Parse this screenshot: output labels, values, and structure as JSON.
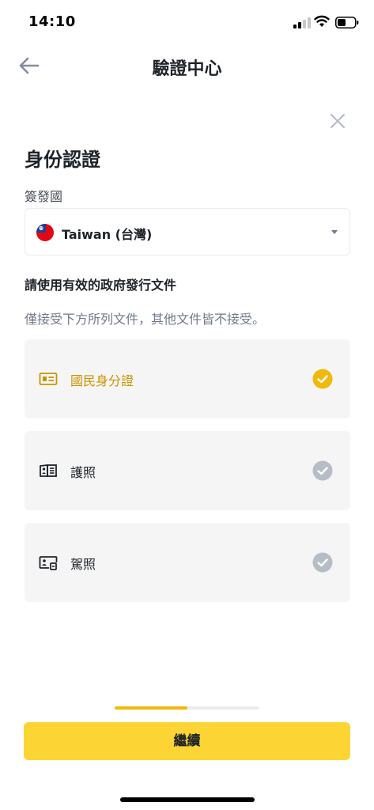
{
  "status_bar": {
    "time": "14:10",
    "icons": [
      "signal-icon",
      "wifi-icon",
      "battery-icon"
    ]
  },
  "nav": {
    "title": "驗證中心",
    "back_icon": "arrow-left-icon"
  },
  "close_icon": "close-icon",
  "identity": {
    "title": "身份認證",
    "country_label": "簽發國",
    "country_value": "Taiwan (台灣)",
    "country_flag_icon": "taiwan-flag-icon",
    "dropdown_icon": "caret-down-icon"
  },
  "documents": {
    "heading": "請使用有效的政府發行文件",
    "note": "僅接受下方所列文件，其他文件皆不接受。",
    "options": [
      {
        "label": "國民身分證",
        "icon": "id-card-icon",
        "selected": true
      },
      {
        "label": "護照",
        "icon": "passport-icon",
        "selected": false
      },
      {
        "label": "駕照",
        "icon": "driver-license-icon",
        "selected": false
      }
    ]
  },
  "progress": {
    "fraction": 0.5
  },
  "continue_button": {
    "label": "繼續"
  },
  "colors": {
    "accent": "#fcd535",
    "selected_text": "#c99400",
    "check_selected": "#f0b90b",
    "check_unselected": "#b7bdc6",
    "option_bg": "#f5f5f5"
  }
}
